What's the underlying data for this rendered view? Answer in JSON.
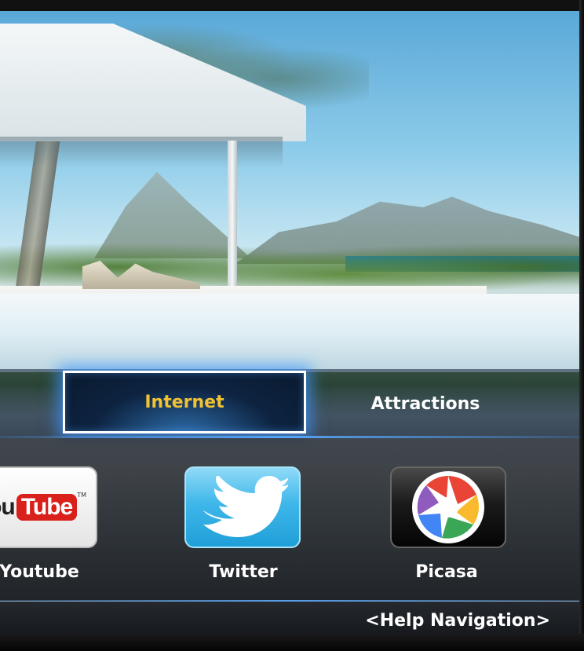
{
  "menu": {
    "items": [
      {
        "label": "Internet",
        "selected": true
      },
      {
        "label": "Attractions",
        "selected": false
      }
    ],
    "selected_color": "#f1c232"
  },
  "apps": [
    {
      "label": "Youtube",
      "icon": "youtube-logo"
    },
    {
      "label": "Twitter",
      "icon": "twitter-bird-icon"
    },
    {
      "label": "Picasa",
      "icon": "picasa-pinwheel-icon"
    }
  ],
  "youtube_logo": {
    "you": "You",
    "tube": "Tube",
    "tm": "TM"
  },
  "help": {
    "label": "<Help Navigation>"
  }
}
